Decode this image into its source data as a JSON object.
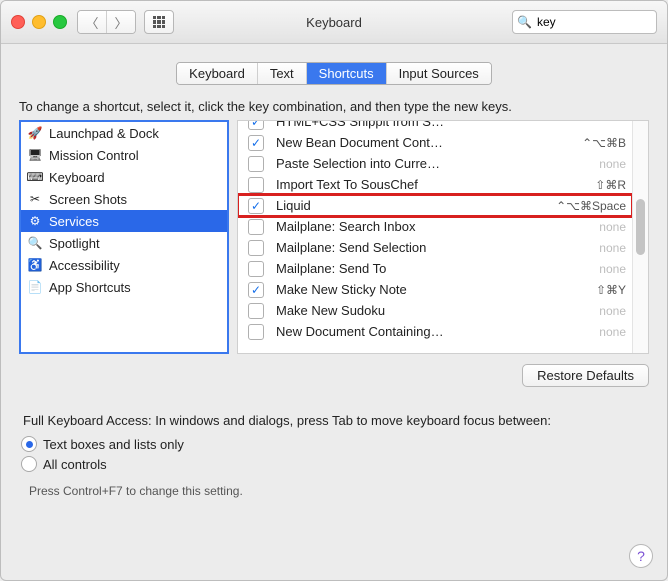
{
  "window": {
    "title": "Keyboard"
  },
  "search": {
    "value": "key",
    "placeholder": "Search"
  },
  "tabs": [
    "Keyboard",
    "Text",
    "Shortcuts",
    "Input Sources"
  ],
  "tabs_active_index": 2,
  "instruction": "To change a shortcut, select it, click the key combination, and then type the new keys.",
  "categories": [
    {
      "icon": "launchpad-icon",
      "label": "Launchpad & Dock"
    },
    {
      "icon": "mission-control-icon",
      "label": "Mission Control"
    },
    {
      "icon": "keyboard-icon",
      "label": "Keyboard"
    },
    {
      "icon": "screenshots-icon",
      "label": "Screen Shots"
    },
    {
      "icon": "services-icon",
      "label": "Services",
      "selected": true
    },
    {
      "icon": "spotlight-icon",
      "label": "Spotlight"
    },
    {
      "icon": "accessibility-icon",
      "label": "Accessibility"
    },
    {
      "icon": "app-shortcuts-icon",
      "label": "App Shortcuts"
    }
  ],
  "services": [
    {
      "checked": true,
      "label": "HTML+CSS Snippit from S…",
      "shortcut": ""
    },
    {
      "checked": true,
      "label": "New Bean Document Cont…",
      "shortcut": "⌃⌥⌘B"
    },
    {
      "checked": false,
      "label": "Paste Selection into Curre…",
      "shortcut": "none"
    },
    {
      "checked": false,
      "label": "Import Text To SousChef",
      "shortcut": "⇧⌘R"
    },
    {
      "checked": true,
      "label": "Liquid",
      "shortcut": "⌃⌥⌘Space",
      "highlighted": true
    },
    {
      "checked": false,
      "label": "Mailplane: Search Inbox",
      "shortcut": "none"
    },
    {
      "checked": false,
      "label": "Mailplane: Send Selection",
      "shortcut": "none"
    },
    {
      "checked": false,
      "label": "Mailplane: Send To",
      "shortcut": "none"
    },
    {
      "checked": true,
      "label": "Make New Sticky Note",
      "shortcut": "⇧⌘Y"
    },
    {
      "checked": false,
      "label": "Make New Sudoku",
      "shortcut": "none"
    },
    {
      "checked": false,
      "label": "New Document Containing…",
      "shortcut": "none"
    }
  ],
  "restore_label": "Restore Defaults",
  "kb_access": {
    "heading": "Full Keyboard Access: In windows and dialogs, press Tab to move keyboard focus between:",
    "options": [
      "Text boxes and lists only",
      "All controls"
    ],
    "selected_index": 0,
    "hint": "Press Control+F7 to change this setting."
  },
  "help_tooltip": "?"
}
